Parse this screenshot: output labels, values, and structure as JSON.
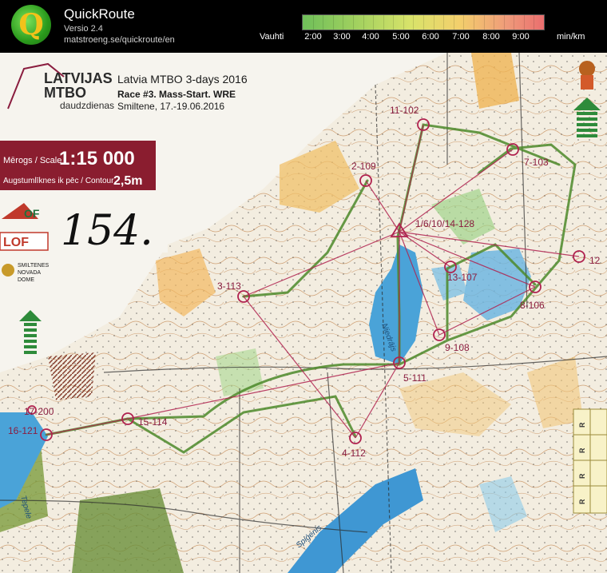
{
  "app": {
    "name": "QuickRoute",
    "version": "Versio 2.4",
    "url": "matstroeng.se/quickroute/en"
  },
  "pace_scale": {
    "label": "Vauhti",
    "unit": "min/km",
    "ticks": [
      "2:00",
      "3:00",
      "4:00",
      "5:00",
      "6:00",
      "7:00",
      "8:00",
      "9:00"
    ]
  },
  "map": {
    "logo_line1": "LATVIJAS",
    "logo_line2": "MTBO",
    "logo_line3": "daudzdienas",
    "event_title": "Latvia MTBO 3-days 2016",
    "race_title": "Race #3. Mass-Start. WRE",
    "place_date": "Smiltene, 17.-19.06.2016",
    "scale_label": "Mērogs / Scale",
    "scale_value": "1:15 000",
    "contour_label": "Augstumlīknes ik pēc / Contour",
    "contour_value": "2,5m",
    "bib_number": "154.",
    "sponsor_of": "OF",
    "sponsor_lof": "LOF",
    "sponsor_smiltene_1": "SMILTENES",
    "sponsor_smiltene_2": "NOVADA",
    "sponsor_smiltene_3": "DOME",
    "lake_name_1": "Niedrājs",
    "lake_name_2": "Spiģenis",
    "lake_name_3": "Tepele",
    "strip_letters": [
      "R",
      "R",
      "R",
      "R"
    ],
    "controls": [
      {
        "label": "11-102"
      },
      {
        "label": "2-109"
      },
      {
        "label": "7-103"
      },
      {
        "label": "1/6/10/14-128"
      },
      {
        "label": "12"
      },
      {
        "label": "13-107"
      },
      {
        "label": "3-113"
      },
      {
        "label": "8-106"
      },
      {
        "label": "9-108"
      },
      {
        "label": "5-111"
      },
      {
        "label": "17-200"
      },
      {
        "label": "15-114"
      },
      {
        "label": "16-121"
      },
      {
        "label": "4-112"
      }
    ]
  }
}
